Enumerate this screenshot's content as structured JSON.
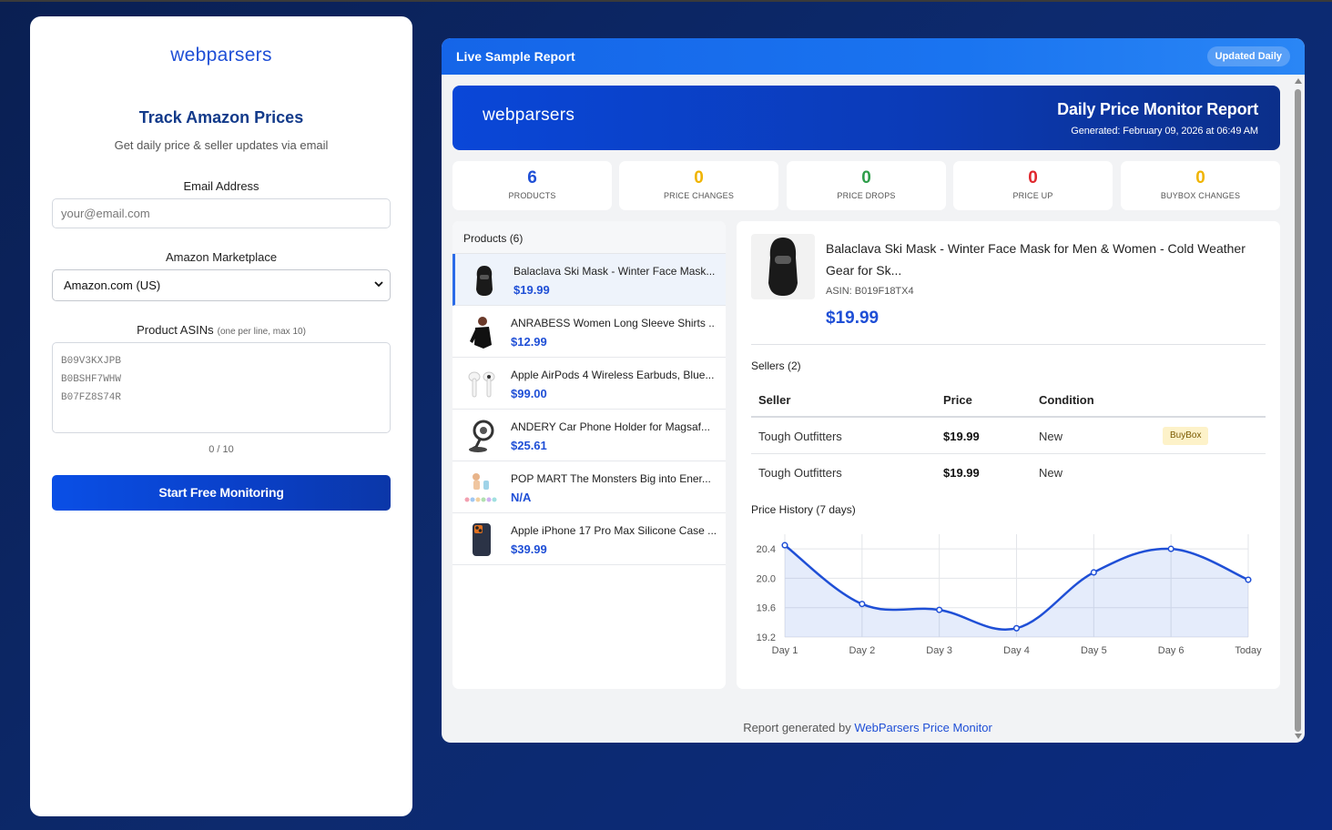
{
  "left": {
    "logo": "webparsers",
    "title": "Track Amazon Prices",
    "subtitle": "Get daily price & seller updates via email",
    "email_label": "Email Address",
    "email_placeholder": "your@email.com",
    "marketplace_label": "Amazon Marketplace",
    "marketplace_value": "Amazon.com (US)",
    "asins_label": "Product ASINs",
    "asins_hint": "(one per line, max 10)",
    "asins_placeholder": [
      "B09V3KXJPB",
      "B0BSHF7WHW",
      "B07FZ8S74R"
    ],
    "counter": "0 / 10",
    "start_button": "Start Free Monitoring"
  },
  "report": {
    "header_title": "Live Sample Report",
    "header_badge": "Updated Daily",
    "banner_logo": "webparsers",
    "banner_title": "Daily Price Monitor Report",
    "banner_generated": "Generated: February 09, 2026 at 06:49 AM",
    "stats": [
      {
        "value": "6",
        "label": "PRODUCTS",
        "color": "#1f4fd6"
      },
      {
        "value": "0",
        "label": "PRICE CHANGES",
        "color": "#f0b400"
      },
      {
        "value": "0",
        "label": "PRICE DROPS",
        "color": "#2e9e4a"
      },
      {
        "value": "0",
        "label": "PRICE UP",
        "color": "#e0282e"
      },
      {
        "value": "0",
        "label": "BUYBOX CHANGES",
        "color": "#f0b400"
      }
    ],
    "products_header": "Products (6)",
    "products": [
      {
        "name": "Balaclava Ski Mask - Winter Face Mask...",
        "price": "$19.99",
        "icon": "balaclava-icon"
      },
      {
        "name": "ANRABESS Women Long Sleeve Shirts ...",
        "price": "$12.99",
        "icon": "shirt-icon"
      },
      {
        "name": "Apple AirPods 4 Wireless Earbuds, Blue...",
        "price": "$99.00",
        "icon": "earbuds-icon"
      },
      {
        "name": "ANDERY Car Phone Holder for Magsaf...",
        "price": "$25.61",
        "icon": "phone-holder-icon"
      },
      {
        "name": "POP MART The Monsters Big into Ener...",
        "price": "N/A",
        "icon": "toy-figures-icon"
      },
      {
        "name": "Apple iPhone 17 Pro Max Silicone Case ...",
        "price": "$39.99",
        "icon": "phone-case-icon"
      }
    ],
    "detail": {
      "title": "Balaclava Ski Mask - Winter Face Mask for Men & Women - Cold Weather Gear for Sk...",
      "asin": "ASIN: B019F18TX4",
      "price": "$19.99",
      "sellers_label": "Sellers (2)",
      "seller_headers": [
        "Seller",
        "Price",
        "Condition"
      ],
      "sellers": [
        {
          "name": "Tough Outfitters",
          "price": "$19.99",
          "condition": "New",
          "badge": "BuyBox"
        },
        {
          "name": "Tough Outfitters",
          "price": "$19.99",
          "condition": "New",
          "badge": ""
        }
      ],
      "history_label": "Price History (7 days)"
    },
    "footer_text": "Report generated by ",
    "footer_link": "WebParsers Price Monitor"
  },
  "chart_data": {
    "type": "line",
    "categories": [
      "Day 1",
      "Day 2",
      "Day 3",
      "Day 4",
      "Day 5",
      "Day 6",
      "Today"
    ],
    "values": [
      20.45,
      19.65,
      19.57,
      19.32,
      20.08,
      20.4,
      19.98
    ],
    "yticks": [
      "20.4",
      "20.0",
      "19.6",
      "19.2"
    ],
    "ylim": [
      19.2,
      20.5
    ],
    "grid": true,
    "fill": true,
    "color": "#1f4fd6"
  }
}
